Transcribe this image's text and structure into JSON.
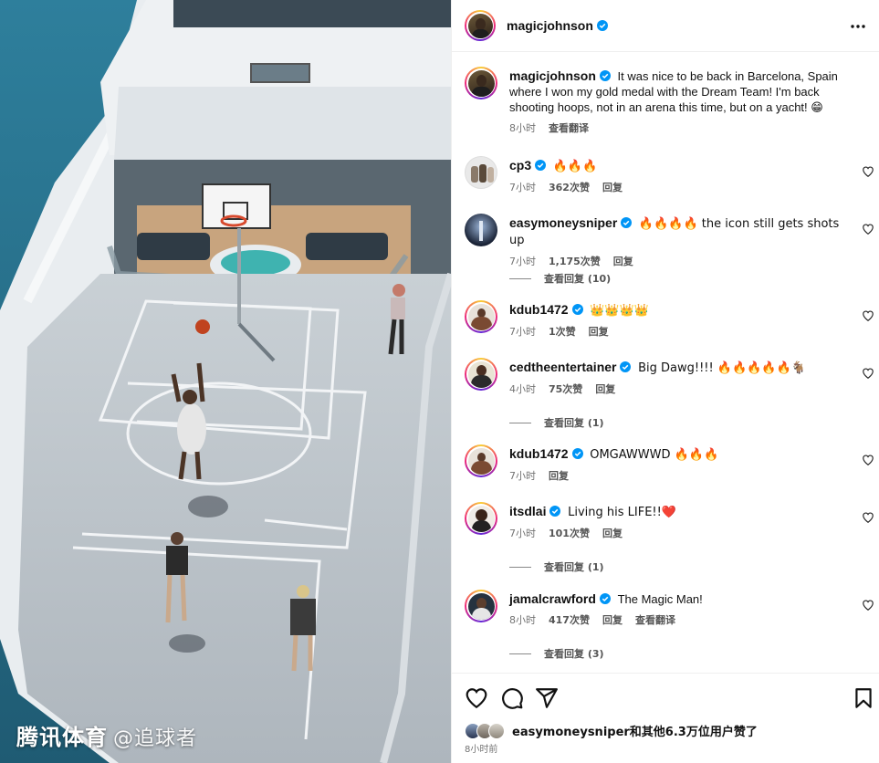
{
  "media": {
    "watermark_brand": "腾讯体育",
    "watermark_sub": "@追球者"
  },
  "post": {
    "author": "magicjohnson",
    "caption_author": "magicjohnson",
    "caption_text": "It was nice to be back in Barcelona, Spain where I won my gold medal with the Dream Team! I'm back shooting hoops, not in an arena this time, but on a yacht! 😁",
    "caption_time": "8小时",
    "caption_translate": "查看翻译"
  },
  "comments": [
    {
      "user": "cp3",
      "text": "🔥🔥🔥",
      "time": "7小时",
      "likes": "362次赞",
      "reply": "回复",
      "translate": ""
    },
    {
      "user": "easymoneysniper",
      "text": "🔥🔥🔥🔥 the icon still gets shots up",
      "time": "7小时",
      "likes": "1,175次赞",
      "reply": "回复",
      "translate": "",
      "view_replies": "查看回复 (10)"
    },
    {
      "user": "kdub1472",
      "text": "👑👑👑👑",
      "time": "7小时",
      "likes": "1次赞",
      "reply": "回复",
      "translate": ""
    },
    {
      "user": "cedtheentertainer",
      "text": "Big Dawg!!!! 🔥🔥🔥🔥🔥🐐",
      "time": "4小时",
      "likes": "75次赞",
      "reply": "回复",
      "translate": "",
      "view_replies": "查看回复 (1)"
    },
    {
      "user": "kdub1472",
      "text": "OMGAWWWD 🔥🔥🔥",
      "time": "7小时",
      "likes": "",
      "reply": "回复",
      "translate": ""
    },
    {
      "user": "itsdlai",
      "text": "Living his LIFE!!❤️",
      "time": "7小时",
      "likes": "101次赞",
      "reply": "回复",
      "translate": "",
      "view_replies": "查看回复 (1)"
    },
    {
      "user": "jamalcrawford",
      "text": "The Magic Man!",
      "time": "8小时",
      "likes": "417次赞",
      "reply": "回复",
      "translate": "查看翻译",
      "view_replies": "查看回复 (3)"
    }
  ],
  "footer": {
    "likes_text": "easymoneysniper和其他6.3万位用户赞了",
    "time_ago": "8小时前"
  },
  "icons": {
    "more": "more-horizontal-icon",
    "like": "heart-icon",
    "comment": "comment-icon",
    "share": "share-icon",
    "save": "bookmark-icon",
    "verified": "verified-badge-icon"
  },
  "colors": {
    "verified": "#0095f6",
    "heart_red": "#e0245e",
    "meta_gray": "#737373"
  }
}
